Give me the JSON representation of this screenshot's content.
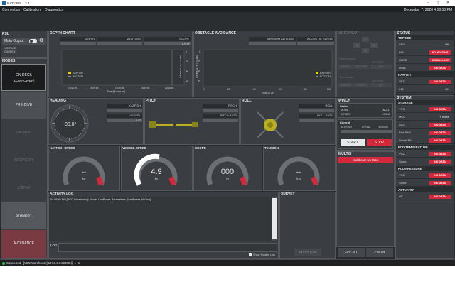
{
  "window": {
    "title": "RATVIEW 1.3.4",
    "min": "–",
    "max": "□",
    "close": "✕"
  },
  "menu": {
    "items": [
      "Connection",
      "Calibration",
      "Diagnostics"
    ],
    "datetime": "December 7, 2020 4:06:50 PM"
  },
  "psu": {
    "title": "PSU",
    "main_output_label": "Main Output",
    "voltage_label": "VOLTAGE",
    "current_label": "CURRENT"
  },
  "modes": {
    "title": "MODES",
    "on_deck": "ON DECK",
    "on_deck_sub": "[LOWPOWER]",
    "items": [
      "PRE-DIVE",
      "LAUNCH",
      "RECOVERY",
      "LOITER",
      "STANDBY",
      "AVOIDANCE"
    ]
  },
  "depth_chart": {
    "title": "DEPTH CHART",
    "cols": [
      "DEPTH",
      "ALTITUDE",
      "SCOPE"
    ],
    "scope_value": "0.0 m",
    "legend": [
      "KATFISH",
      "BOTTOM"
    ],
    "y_ticks": [
      "0",
      "20",
      "40",
      "60"
    ],
    "x_ticks": [
      "16:06:55",
      "16:06:55",
      "16:06:55",
      "16:06:55",
      "16:06:55"
    ],
    "xlabel": "Time [hh:mm:ss]",
    "ylabel": "DEPTH / ALTITUDE [m]"
  },
  "obstacle": {
    "title": "OBSTACLE AVOIDANCE",
    "cols": [
      "MINIMUM ALTITUDE",
      "ACOUSTIC RANGE"
    ],
    "legend": [
      "KATFISH",
      "BOTTOM"
    ],
    "x_ticks": [
      "0",
      "20",
      "40",
      "60",
      "80",
      "100"
    ],
    "y_ticks": [
      "0",
      "20",
      "40",
      "60"
    ],
    "xlabel": "RANGE [m]",
    "ylabel": "DEPTH / ALTITUDE [m]"
  },
  "autopilot": {
    "title": "AUTOPILOT",
    "pitch_control": "Pitch Control",
    "tow_control": "Tow Control",
    "depth": "DEPTH",
    "altitude": "ALTITUDE",
    "setpoint": "SETPOINT",
    "set": "SET",
    "tension": "TENSION",
    "scope": "SCOPE"
  },
  "heading": {
    "title": "HEADING",
    "value": "-00.0°",
    "rows": [
      "KATFISH",
      "VESSEL"
    ],
    "vessel_value": "0.0°"
  },
  "pitch": {
    "title": "PITCH",
    "rows": [
      "PITCH",
      "PITCH RATE"
    ]
  },
  "roll": {
    "title": "ROLL",
    "rows": [
      "ROLL",
      "ROLL RATE"
    ]
  },
  "winch": {
    "title": "WINCH",
    "status_label": "Status",
    "mode_label": "MODE",
    "mode_value": "AUTO",
    "action_label": "ACTION",
    "action_value": "HOLD",
    "control_label": "Control",
    "setpoint": "SETPOINT",
    "speed": "SPEED",
    "tension": "TENSION",
    "start": "START",
    "stop": "STOP"
  },
  "multis": {
    "title": "MULTIS",
    "message": "Multibeam No Data"
  },
  "gauges": [
    {
      "title": "KATFISH SPEED",
      "value": "--",
      "unit": "kn",
      "level": 0.0
    },
    {
      "title": "VESSEL SPEED",
      "value": "4.9",
      "unit": "kn",
      "level": 0.55
    },
    {
      "title": "SCOPE",
      "value": "000",
      "unit": "m",
      "level": 0.0
    },
    {
      "title": "TENSION",
      "value": "--",
      "unit": "kN",
      "level": 0.0
    }
  ],
  "activity": {
    "title": "ACTIVITY LOG",
    "entry": "04:05:45 PM [VCC-Warehouse]: Mode: LowPower Parameters: [LowPower, NoTow]",
    "log_label": "LOG",
    "show_system_log": "Show System Log"
  },
  "survey": {
    "title": "SURVEY",
    "start_line": "START LINE"
  },
  "bottom_buttons": {
    "ack_all": "ACK ALL",
    "clear": "CLEAR"
  },
  "status": {
    "title": "STATUS",
    "topside_label": "TOPSIDE",
    "topside": [
      {
        "name": "CPU",
        "value": "OK",
        "alarm": false
      },
      {
        "name": "INS",
        "value": "NO HEADING",
        "alarm": true
      },
      {
        "name": "GNSS",
        "value": "SIGNAL LOST",
        "alarm": true
      },
      {
        "name": "USBL",
        "value": "NO DATA",
        "alarm": true
      }
    ],
    "katfish_label": "KATFISH",
    "katfish": [
      {
        "name": "GEO",
        "value": "NO DATA",
        "alarm": true
      },
      {
        "name": "INS",
        "value": "OK",
        "alarm": false
      }
    ]
  },
  "system": {
    "title": "SYSTEM",
    "storage_label": "STORAGE",
    "storage": [
      {
        "name": "VCC",
        "value": "NO DATA",
        "alarm": true
      },
      {
        "name": "MCC",
        "value": "9 hours",
        "alarm": false
      },
      {
        "name": "SCC",
        "value": "NO DATA",
        "alarm": true
      },
      {
        "name": "Port NAS",
        "value": "NO DATA",
        "alarm": true
      },
      {
        "name": "Stbd NAS",
        "value": "NO DATA",
        "alarm": true
      }
    ],
    "pod_temp_label": "POD TEMPERATURE",
    "pod_temp": [
      {
        "name": "VCC",
        "value": "NO DATA",
        "alarm": true
      },
      {
        "name": "Sonar",
        "value": "NO DATA",
        "alarm": true
      }
    ],
    "pod_pressure_label": "POD PRESSURE",
    "pod_pressure": [
      {
        "name": "VCC",
        "value": "NO DATA",
        "alarm": true
      },
      {
        "name": "Sonar",
        "value": "NO DATA",
        "alarm": true
      }
    ],
    "actuator_label": "ACTUATOR",
    "actuator": [
      {
        "name": "OK",
        "value": "NO DATA",
        "alarm": true
      }
    ]
  },
  "statusbar": {
    "text": "Connected   [VCC-Warehouse] 127.0.0.1:29000 @ 1 Hz"
  },
  "colors": {
    "accent_red": "#d4283c",
    "panel": "#3a3e42",
    "header": "#2a2d30",
    "chart_line": "#e8d400"
  }
}
